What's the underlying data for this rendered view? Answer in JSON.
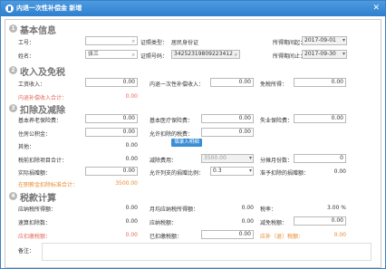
{
  "window": {
    "title": "内退一次性补偿金 新增",
    "close": "✕"
  },
  "section1": {
    "num": "1",
    "title": "基本信息",
    "job_no_label": "工号：",
    "job_no_value": "",
    "name_label": "姓名：",
    "name_value": "张三",
    "id_type_label": "证照类型：",
    "id_type_value": "居民身份证",
    "id_no_label": "证照号码：",
    "id_no_value": "34252319809223412",
    "period_start_label": "所得期间起：",
    "period_start_value": "2017-09-01",
    "period_end_label": "所得期间止：",
    "period_end_value": "2017-09-30"
  },
  "section2": {
    "num": "2",
    "title": "收入及免税",
    "salary_label": "工资收入：",
    "salary_value": "0.00",
    "comp_label": "内退一次性补偿收入：",
    "comp_value": "0.00",
    "exempt_label": "免税所得：",
    "exempt_value": "0.00",
    "comp_sum_label": "内退补偿收入合计：",
    "comp_sum_value": "0.00"
  },
  "section3": {
    "num": "3",
    "title": "扣除及减除",
    "pension_label": "基本养老保险费：",
    "pension_value": "0.00",
    "medical_label": "基本医疗保险费：",
    "medical_value": "0.00",
    "unemployment_label": "失业保险费：",
    "unemployment_value": "0.00",
    "housing_label": "住房公积金：",
    "housing_value": "0.00",
    "donation_label": "允许扣除的税费：",
    "donation_value": "0.00",
    "input_button": "填录入明细",
    "other_label": "其他：",
    "other_value": "0.00",
    "pretax_total_label": "税前扣除项目合计：",
    "pretax_total_value": "0.00",
    "deduction_label": "减除费用：",
    "deduction_value": "3500.00",
    "split_months_label": "分摊月份数：",
    "split_months_value": "0",
    "actual_donation_label": "实际捐赠额：",
    "actual_donation_value": "0.00",
    "ratio_label": "允许列支的捐赠比例：",
    "ratio_value": "0.3",
    "pretax_donation_label": "准予扣除的捐赠额：",
    "pretax_donation_value": "0.00",
    "standard_label": "在职薪金扣除标准合计：",
    "standard_value": "3500.00"
  },
  "section4": {
    "num": "4",
    "title": "税款计算",
    "taxable_label": "应纳税所得额：",
    "taxable_value": "0.00",
    "monthly_taxable_label": "月均应纳税所得额：",
    "monthly_taxable_value": "0.00",
    "rate_label": "税率：",
    "rate_value": "3.00 %",
    "quick_label": "速算扣除数：",
    "quick_value": "0.00",
    "tax_payable_label": "应纳税额：",
    "tax_payable_value": "0.00",
    "tax_reduction_label": "减免税额：",
    "tax_reduction_value": "0.00",
    "tax_due_label": "应扣缴税额：",
    "tax_due_value": "0.00",
    "withheld_label": "已扣缴税额：",
    "withheld_value": "0.00",
    "refund_label": "应补（退）税额：",
    "refund_value": "0.00",
    "remark_label": "备注："
  }
}
